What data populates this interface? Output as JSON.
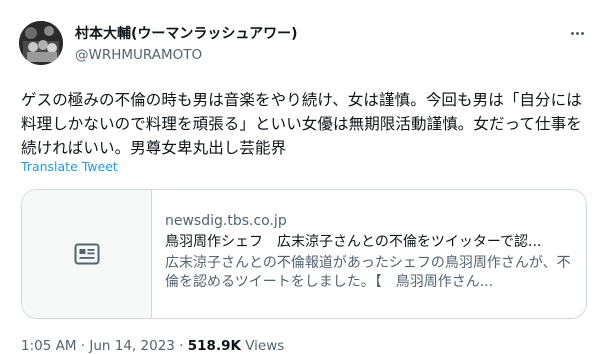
{
  "author": {
    "display_name": "村本大輔(ウーマンラッシュアワー)",
    "handle": "@WRHMURAMOTO"
  },
  "tweet": {
    "text": "ゲスの極みの不倫の時も男は音楽をやり続け、女は謹慎。今回も男は「自分には料理しかないので料理を頑張る」といい女優は無期限活動謹慎。女だって仕事を続ければいい。男尊女卑丸出し芸能界",
    "translate_label": "Translate Tweet"
  },
  "card": {
    "domain": "newsdig.tbs.co.jp",
    "title": "鳥羽周作シェフ　広末涼子さんとの不倫をツイッターで認...",
    "description": "広末涼子さんとの不倫報道があったシェフの鳥羽周作さんが、不倫を認めるツイートをしました。【　鳥羽周作さん...",
    "thumbnail_icon": "article-icon"
  },
  "meta": {
    "time": "1:05 AM",
    "sep1": " · ",
    "date": "Jun 14, 2023",
    "sep2": " · ",
    "views_count": "518.9K",
    "views_label": " Views"
  },
  "icons": {
    "more": "more-horizontal-icon"
  },
  "colors": {
    "link": "#1d9bf0",
    "secondary_text": "#536471",
    "border": "#cfd9de"
  }
}
